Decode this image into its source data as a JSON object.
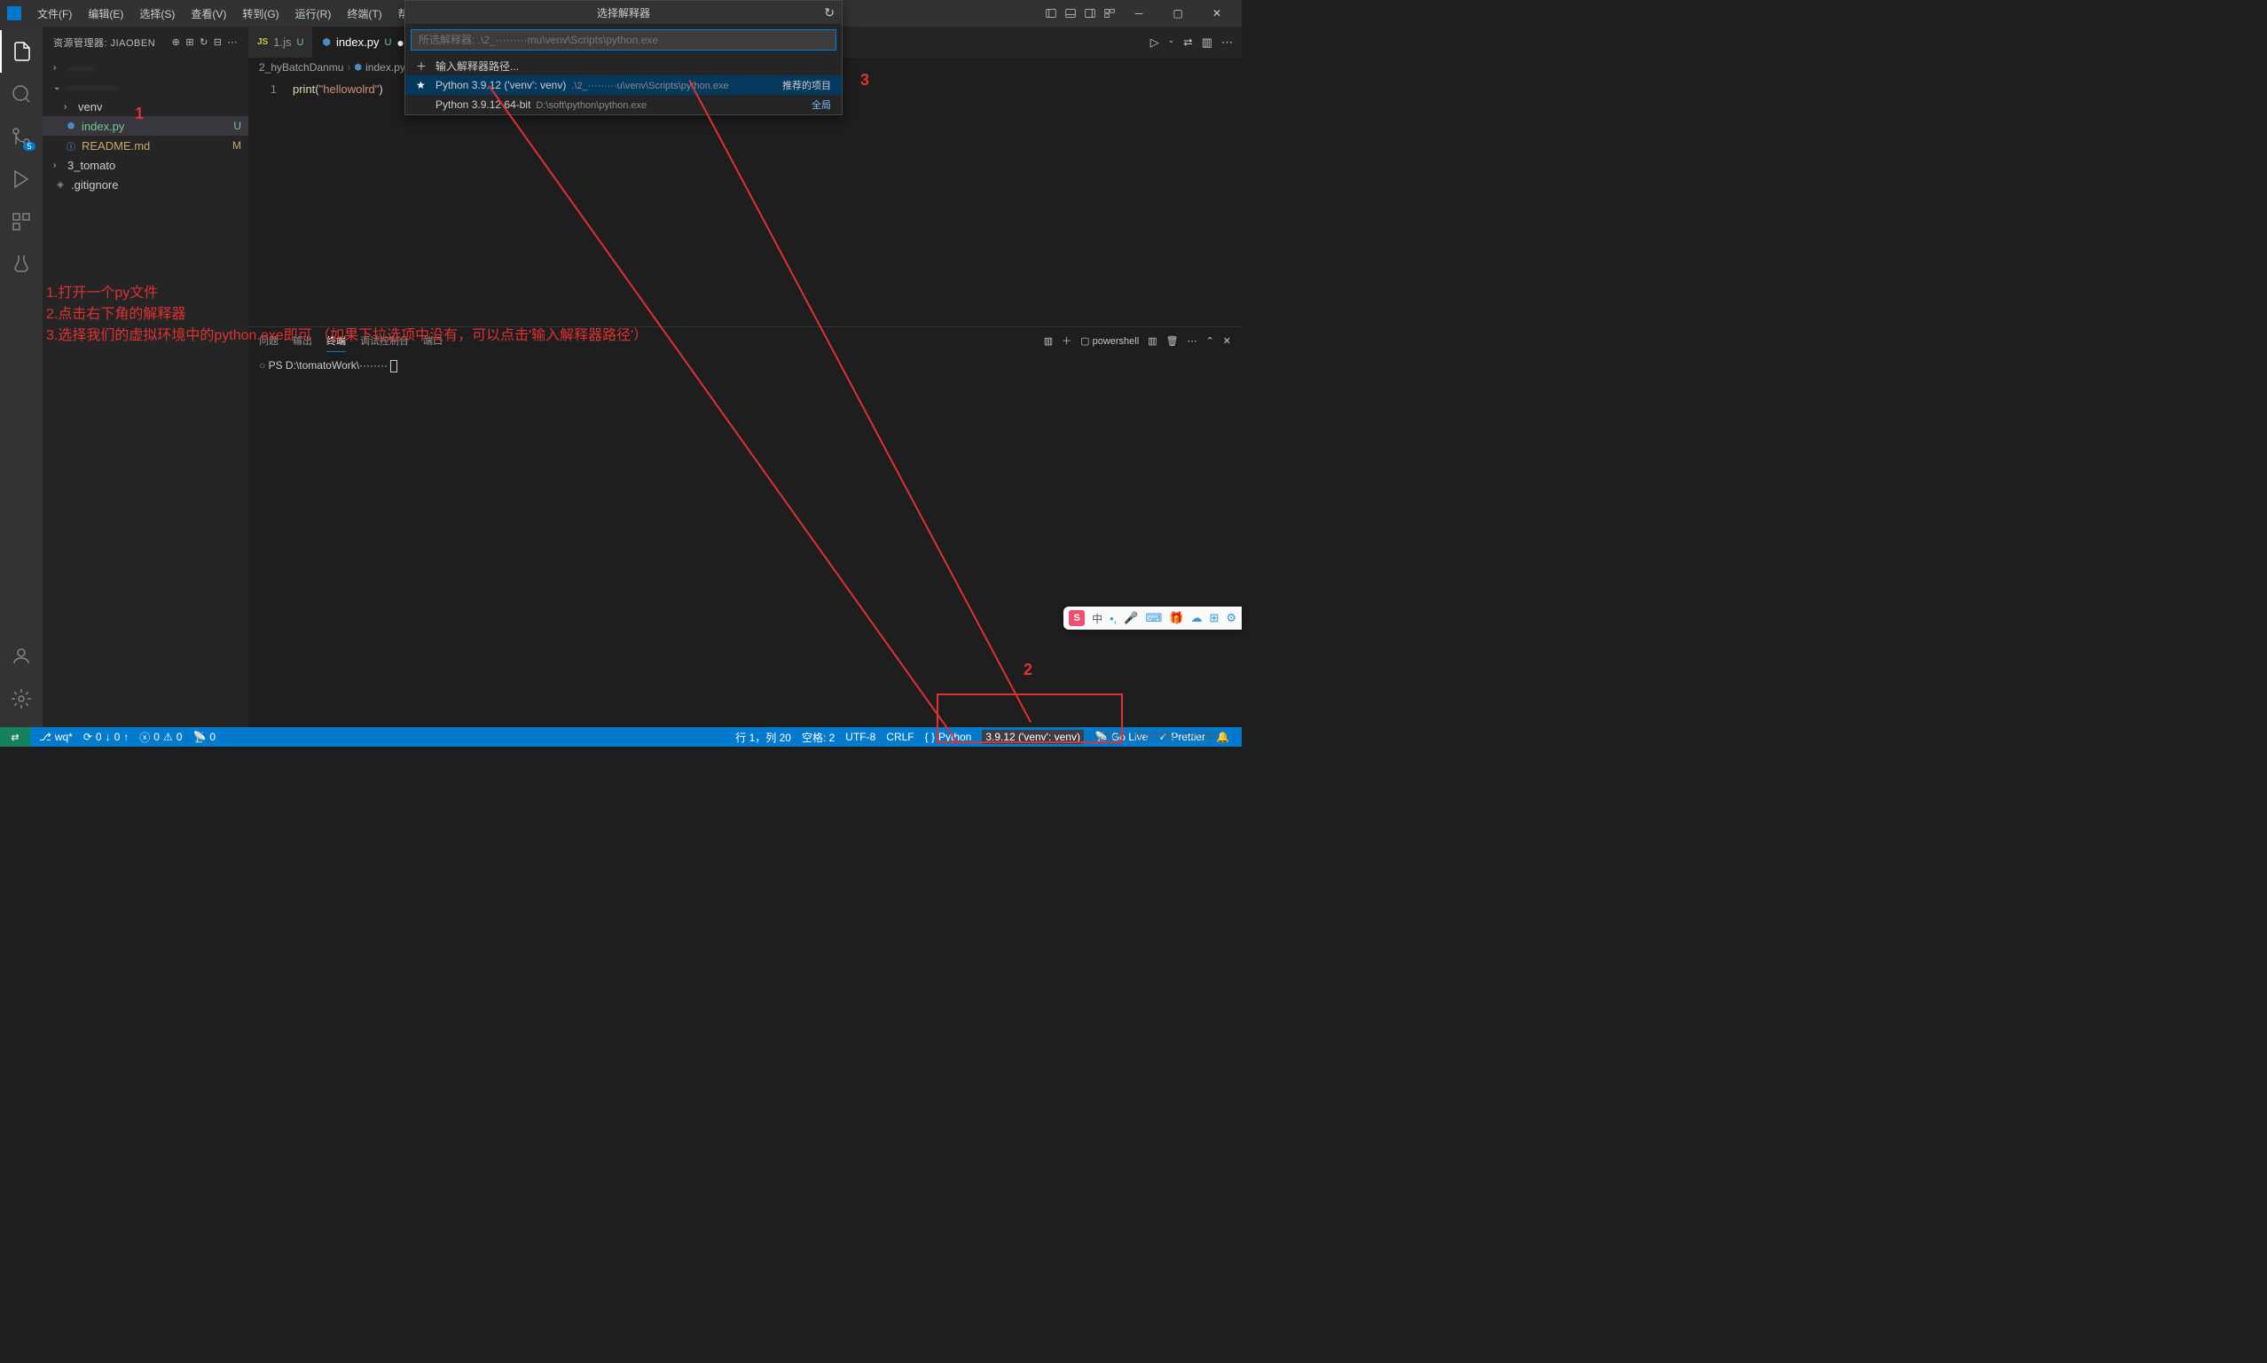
{
  "menu": {
    "file": "文件(F)",
    "edit": "编辑(E)",
    "select": "选择(S)",
    "view": "查看(V)",
    "go": "转到(G)",
    "run": "运行(R)",
    "terminal": "终端(T)",
    "help": "帮助(H)"
  },
  "sidebar": {
    "title": "资源管理器: JIAOBEN",
    "items": [
      {
        "type": "folder",
        "label": "·······",
        "chevron": "›",
        "blurred": true
      },
      {
        "type": "folder-open",
        "label": "·············",
        "chevron": "⌄",
        "blurred": true
      },
      {
        "type": "folder",
        "label": "venv",
        "chevron": "›",
        "indent": 1
      },
      {
        "type": "file",
        "label": "index.py",
        "icon": "py",
        "status": "U",
        "selected": true,
        "indent": 1
      },
      {
        "type": "file",
        "label": "README.md",
        "icon": "md",
        "status": "M",
        "indent": 1
      },
      {
        "type": "folder",
        "label": "3_tomato",
        "chevron": "›"
      },
      {
        "type": "file",
        "label": ".gitignore",
        "icon": "git"
      }
    ]
  },
  "tabs": [
    {
      "icon": "js",
      "label": "1.js",
      "status": "U"
    },
    {
      "icon": "py",
      "label": "index.py",
      "status": "U",
      "active": true
    }
  ],
  "breadcrumb": {
    "parts": [
      "2_hyBatchDanmu",
      "index.py"
    ]
  },
  "editor": {
    "lineno": "1",
    "code_func": "print",
    "code_paren_open": "(",
    "code_str": "\"hellowolrd\"",
    "code_paren_close": ")"
  },
  "interpreter": {
    "title": "选择解释器",
    "placeholder": "所选解释器: .\\2_·········mu\\venv\\Scripts\\python.exe",
    "add_path": "输入解释器路径...",
    "options": [
      {
        "star": true,
        "label": "Python 3.9.12 ('venv': venv)",
        "path": ".\\2_·········u\\venv\\Scripts\\python.exe",
        "tag": "推荐的项目",
        "highlighted": true
      },
      {
        "star": false,
        "label": "Python 3.9.12 64-bit",
        "path": "D:\\soft\\python\\python.exe",
        "tag": "全局"
      }
    ]
  },
  "terminal": {
    "tabs": {
      "problems": "问题",
      "output": "输出",
      "term": "终端",
      "debug": "调试控制台",
      "ports": "端口"
    },
    "shell": "powershell",
    "prompt": "PS D:\\tomatoWork\\········"
  },
  "statusbar": {
    "branch": "wq*",
    "sync_down": "0",
    "sync_up": "0",
    "errors": "0",
    "warnings": "0",
    "ports": "0",
    "line_col": "行 1，列 20",
    "spaces": "空格: 2",
    "encoding": "UTF-8",
    "eol": "CRLF",
    "language": "Python",
    "interpreter": "3.9.12 ('venv': venv)",
    "live": "Go Live",
    "prettier": "Prettier"
  },
  "annotations": {
    "num1": "1",
    "num2": "2",
    "num3": "3",
    "line1": "1.打开一个py文件",
    "line2": "2.点击右下角的解释器",
    "line3": "3.选择我们的虚拟环境中的python.exe即可  （如果下拉选项中没有，可以点击'输入解释器路径'）"
  },
  "ime": {
    "lang": "中"
  },
  "watermark": "CSDN @pretty_tomato"
}
